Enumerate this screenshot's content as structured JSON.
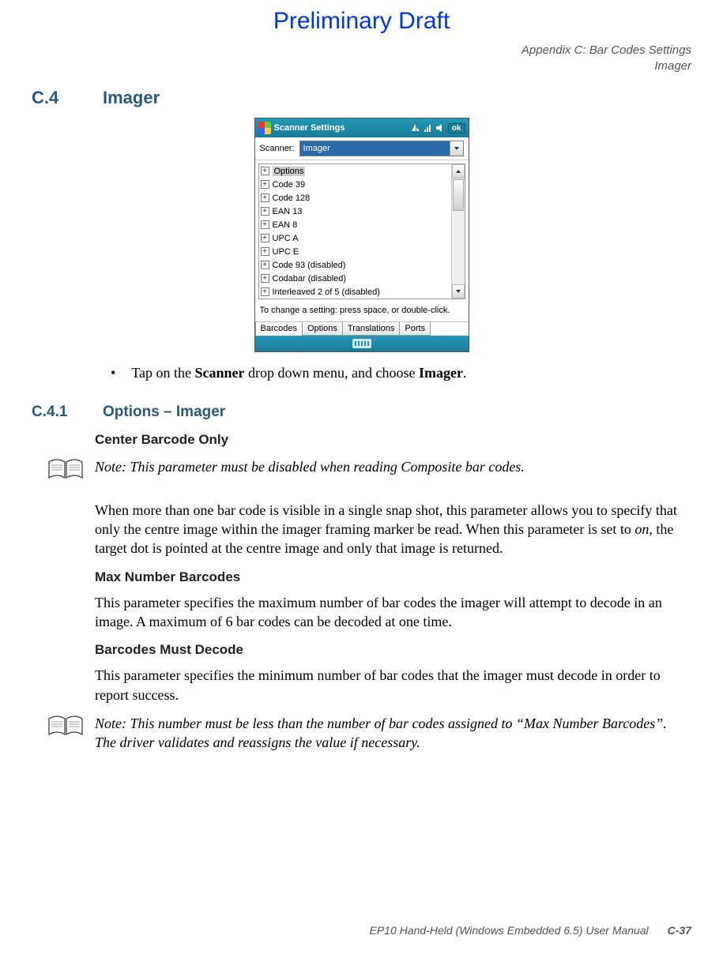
{
  "draft": "Preliminary Draft",
  "header": {
    "line1": "Appendix C: Bar Codes Settings",
    "line2": "Imager"
  },
  "sec_c4": {
    "num": "C.4",
    "title": "Imager"
  },
  "bullet1": {
    "pre": "Tap on the ",
    "b1": "Scanner",
    "mid": " drop down menu, and choose ",
    "b2": "Imager",
    "post": "."
  },
  "sec_c41": {
    "num": "C.4.1",
    "title": "Options – Imager"
  },
  "h3_center": "Center Barcode Only",
  "note1": {
    "label": "Note:",
    "text": " This parameter must be disabled when reading Composite bar codes."
  },
  "para_center": {
    "p1": "When more than one bar code is visible in a single snap shot, this parameter allows you to specify that only the centre image within the imager framing marker be read. When this parameter is set to ",
    "on": "on",
    "p2": ", the target dot is pointed at the centre image and only that image is returned."
  },
  "h3_max": "Max Number Barcodes",
  "para_max": "This parameter specifies the maximum number of bar codes the imager will attempt to decode in an image. A maximum of 6 bar codes can be decoded at one time.",
  "h3_must": "Barcodes Must Decode",
  "para_must": "This parameter specifies the minimum number of bar codes that the imager must decode in order to report success.",
  "note2": {
    "label": "Note:",
    "text": " This number must be less than the number of bar codes assigned to “Max Number Barcodes”. The driver validates and reassigns the value if necessary."
  },
  "footer": {
    "text": "EP10 Hand-Held (Windows Embedded 6.5) User Manual",
    "page": "C-37"
  },
  "shot": {
    "title": "Scanner Settings",
    "ok": "ok",
    "scanner_label": "Scanner:",
    "scanner_value": "Imager",
    "items": [
      "Options",
      "Code 39",
      "Code 128",
      "EAN 13",
      "EAN 8",
      "UPC A",
      "UPC E",
      "Code 93 (disabled)",
      "Codabar (disabled)",
      "Interleaved 2 of 5 (disabled)"
    ],
    "hint": "To change a setting: press space, or double-click.",
    "tabs": [
      "Barcodes",
      "Options",
      "Translations",
      "Ports"
    ]
  }
}
